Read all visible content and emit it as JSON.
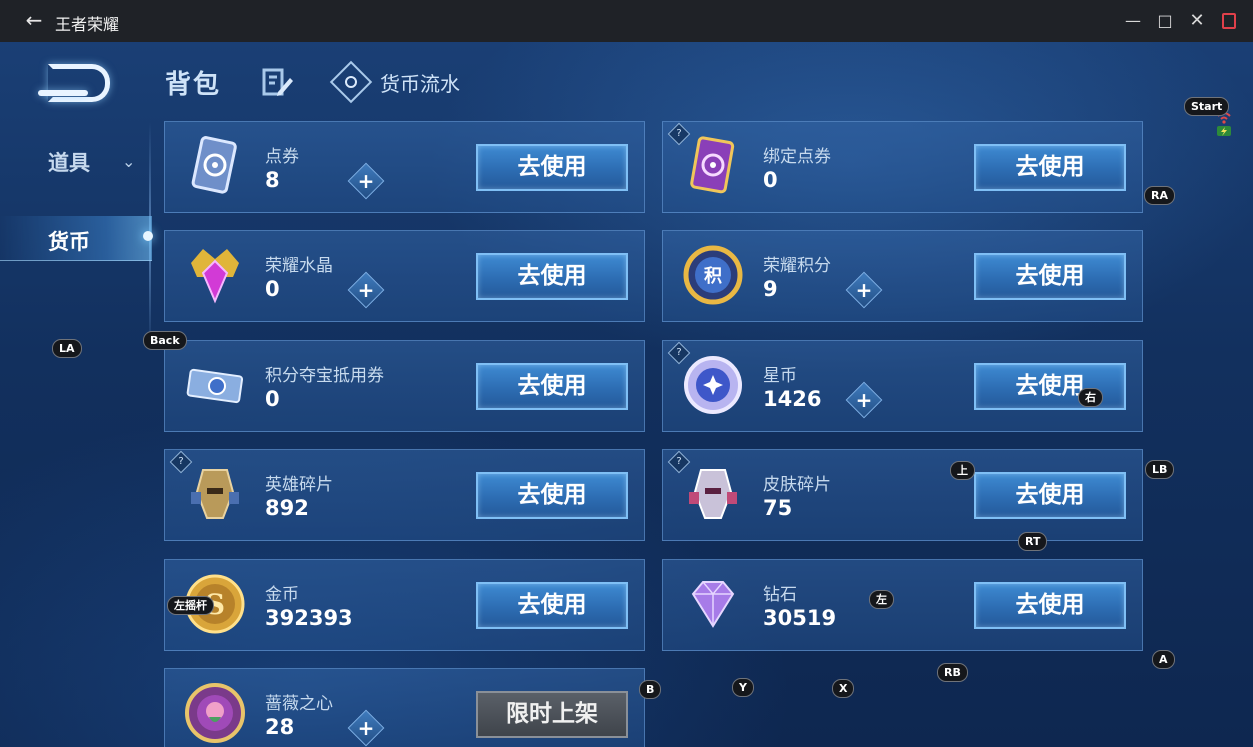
{
  "window": {
    "title": "王者荣耀",
    "back_icon": "arrow-left-icon",
    "controls": [
      "minimize-icon",
      "maximize-icon",
      "close-icon",
      "sidebar-toggle-icon"
    ]
  },
  "header": {
    "title": "背包",
    "edit_icon": "edit-icon",
    "flow_label": "货币流水"
  },
  "nav": {
    "props_label": "道具",
    "currency_label": "货币",
    "selected": "货币"
  },
  "currencies": [
    {
      "name": "点券",
      "value": "8",
      "has_plus": true,
      "has_question": false,
      "button": "去使用",
      "icon": "coupon-icon"
    },
    {
      "name": "绑定点券",
      "value": "0",
      "has_plus": false,
      "has_question": true,
      "button": "去使用",
      "icon": "bound-coupon-icon"
    },
    {
      "name": "荣耀水晶",
      "value": "0",
      "has_plus": true,
      "has_question": false,
      "button": "去使用",
      "icon": "glory-crystal-icon"
    },
    {
      "name": "荣耀积分",
      "value": "9",
      "has_plus": true,
      "has_question": false,
      "button": "去使用",
      "icon": "glory-points-icon"
    },
    {
      "name": "积分夺宝抵用券",
      "value": "0",
      "has_plus": false,
      "has_question": false,
      "button": "去使用",
      "icon": "voucher-icon"
    },
    {
      "name": "星币",
      "value": "1426",
      "has_plus": true,
      "has_question": true,
      "button": "去使用",
      "icon": "star-coin-icon"
    },
    {
      "name": "英雄碎片",
      "value": "892",
      "has_plus": false,
      "has_question": true,
      "button": "去使用",
      "icon": "hero-shard-icon"
    },
    {
      "name": "皮肤碎片",
      "value": "75",
      "has_plus": false,
      "has_question": true,
      "button": "去使用",
      "icon": "skin-shard-icon"
    },
    {
      "name": "金币",
      "value": "392393",
      "has_plus": false,
      "has_question": false,
      "button": "去使用",
      "icon": "gold-coin-icon"
    },
    {
      "name": "钻石",
      "value": "30519",
      "has_plus": false,
      "has_question": false,
      "button": "去使用",
      "icon": "diamond-icon"
    },
    {
      "name": "蔷薇之心",
      "value": "28",
      "has_plus": true,
      "has_question": false,
      "button": "限时上架",
      "icon": "rose-heart-icon"
    }
  ],
  "controller_badges": [
    "Start",
    "RA",
    "LA",
    "Back",
    "右",
    "上",
    "LB",
    "RT",
    "左摇杆",
    "左",
    "A",
    "RB",
    "B",
    "Y",
    "X"
  ],
  "colors": {
    "titlebar": "#1f2227",
    "background": "#12305e",
    "button": "#2d6db3",
    "button_disabled": "#4a4f56"
  }
}
